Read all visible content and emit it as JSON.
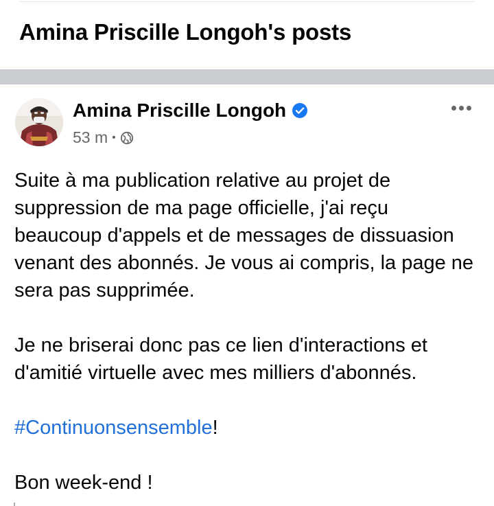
{
  "header": {
    "title": "Amina Priscille Longoh's posts"
  },
  "post": {
    "author": "Amina Priscille Longoh",
    "time": "53 m",
    "separator": "•",
    "paragraphs": [
      "Suite à ma publication relative au projet de suppression de ma page officielle, j'ai reçu beaucoup d'appels et de messages de dissuasion venant des abonnés. Je vous ai compris, la page ne sera pas supprimée.",
      "Je ne briserai donc pas ce lien d'interactions et d'amitié virtuelle avec mes milliers d'abonnés."
    ],
    "hashtag": "#Continuonsensemble",
    "hashtag_suffix": "!",
    "closing": "Bon week-end !"
  },
  "icons": {
    "verified": "verified-badge-icon",
    "audience": "globe-icon",
    "more": "more-options-icon"
  },
  "colors": {
    "link": "#216fdb",
    "verified": "#1877f2",
    "divider": "#c9ccd1",
    "meta_text": "#65676b"
  }
}
